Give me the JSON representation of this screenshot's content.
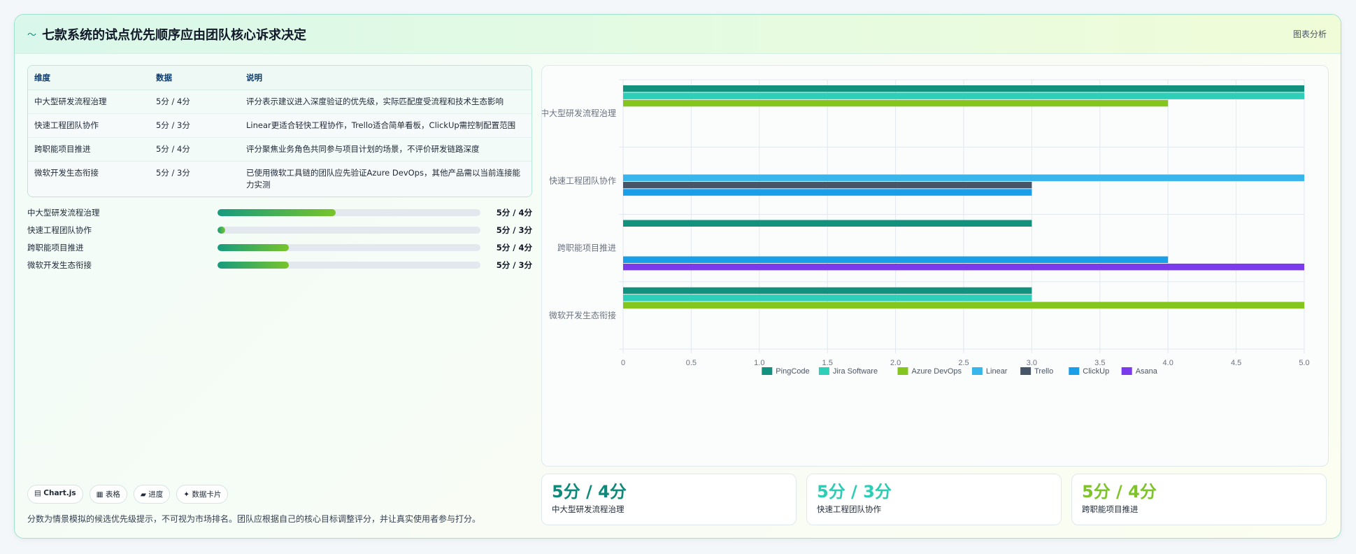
{
  "header": {
    "icon": "wave-icon",
    "title": "七款系统的试点优先顺序应由团队核心诉求决定",
    "link": "图表分析"
  },
  "table": {
    "headers": [
      "维度",
      "数据",
      "说明"
    ],
    "rows": [
      {
        "dimension": "中大型研发流程治理",
        "data": "5分 / 4分",
        "note": "评分表示建议进入深度验证的优先级，实际匹配度受流程和技术生态影响"
      },
      {
        "dimension": "快速工程团队协作",
        "data": "5分 / 3分",
        "note": "Linear更适合轻快工程协作，Trello适合简单看板，ClickUp需控制配置范围"
      },
      {
        "dimension": "跨职能项目推进",
        "data": "5分 / 4分",
        "note": "评分聚焦业务角色共同参与项目计划的场景，不评价研发链路深度"
      },
      {
        "dimension": "微软开发生态衔接",
        "data": "5分 / 3分",
        "note": "已使用微软工具链的团队应先验证Azure DevOps，其他产品需以当前连接能力实测"
      }
    ]
  },
  "progress": [
    {
      "label": "中大型研发流程治理",
      "value": "5分 / 4分",
      "fraction": 0.45
    },
    {
      "label": "快速工程团队协作",
      "value": "5分 / 3分",
      "fraction": 0.03
    },
    {
      "label": "跨职能项目推进",
      "value": "5分 / 4分",
      "fraction": 0.27
    },
    {
      "label": "微软开发生态衔接",
      "value": "5分 / 3分",
      "fraction": 0.27
    }
  ],
  "chips": [
    {
      "icon": "▤",
      "label": "Chart.js",
      "bold": true
    },
    {
      "icon": "▦",
      "label": "表格",
      "bold": false
    },
    {
      "icon": "▰",
      "label": "进度",
      "bold": false
    },
    {
      "icon": "✦",
      "label": "数据卡片",
      "bold": false
    }
  ],
  "footnote": "分数为情景模拟的候选优先级提示，不可视为市场排名。团队应根据自己的核心目标调整评分，并让真实使用者参与打分。",
  "stats": [
    {
      "value": "5分 / 4分",
      "label": "中大型研发流程治理",
      "color": "#0f8a7a"
    },
    {
      "value": "5分 / 3分",
      "label": "快速工程团队协作",
      "color": "#2ccdb4"
    },
    {
      "value": "5分 / 4分",
      "label": "跨职能项目推进",
      "color": "#7ec32a"
    }
  ],
  "chart_data": {
    "type": "bar",
    "orientation": "horizontal",
    "categories": [
      "中大型研发流程治理",
      "快速工程团队协作",
      "跨职能项目推进",
      "微软开发生态衔接"
    ],
    "series": [
      {
        "name": "PingCode",
        "color": "#13917f",
        "values": [
          5,
          null,
          3,
          3
        ]
      },
      {
        "name": "Jira Software",
        "color": "#2dcfb9",
        "values": [
          5,
          null,
          null,
          3
        ]
      },
      {
        "name": "Azure DevOps",
        "color": "#84c51e",
        "values": [
          4,
          null,
          null,
          5
        ]
      },
      {
        "name": "Linear",
        "color": "#38b6ec",
        "values": [
          null,
          5,
          null,
          null
        ]
      },
      {
        "name": "Trello",
        "color": "#475569",
        "values": [
          null,
          3,
          null,
          null
        ]
      },
      {
        "name": "ClickUp",
        "color": "#1a9ee8",
        "values": [
          null,
          3,
          4,
          null
        ]
      },
      {
        "name": "Asana",
        "color": "#7c3aed",
        "values": [
          null,
          null,
          5,
          null
        ]
      }
    ],
    "xticks": [
      "0",
      "0.5",
      "1.0",
      "1.5",
      "2.0",
      "2.5",
      "3.0",
      "3.5",
      "4.0",
      "4.5",
      "5.0"
    ],
    "xlim": [
      0,
      5
    ],
    "grid": true,
    "legend": "bottom",
    "title": "",
    "xlabel": "",
    "ylabel": ""
  }
}
